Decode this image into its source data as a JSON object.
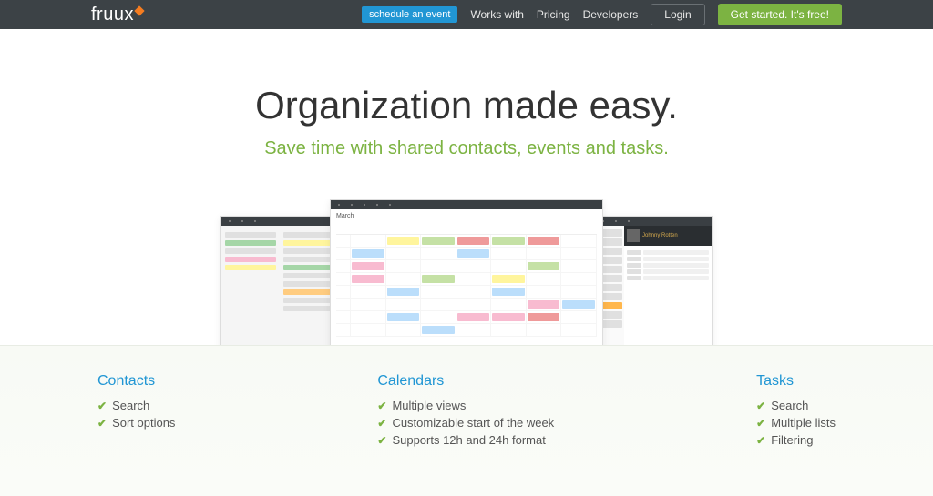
{
  "nav": {
    "logo": "fruux",
    "schedule": "schedule an event",
    "links": [
      "Works with",
      "Pricing",
      "Developers"
    ],
    "login": "Login",
    "getstarted": "Get started. It's free!"
  },
  "hero": {
    "title": "Organization made easy.",
    "subtitle": "Save time with shared contacts, events and tasks."
  },
  "calendar": {
    "month": "March",
    "contact_name": "Johnny Rotten"
  },
  "features": {
    "contacts": {
      "title": "Contacts",
      "items": [
        "Search",
        "Sort options"
      ]
    },
    "calendars": {
      "title": "Calendars",
      "items": [
        "Multiple views",
        "Customizable start of the week",
        "Supports 12h and 24h format"
      ]
    },
    "tasks": {
      "title": "Tasks",
      "items": [
        "Search",
        "Multiple lists",
        "Filtering"
      ]
    }
  }
}
